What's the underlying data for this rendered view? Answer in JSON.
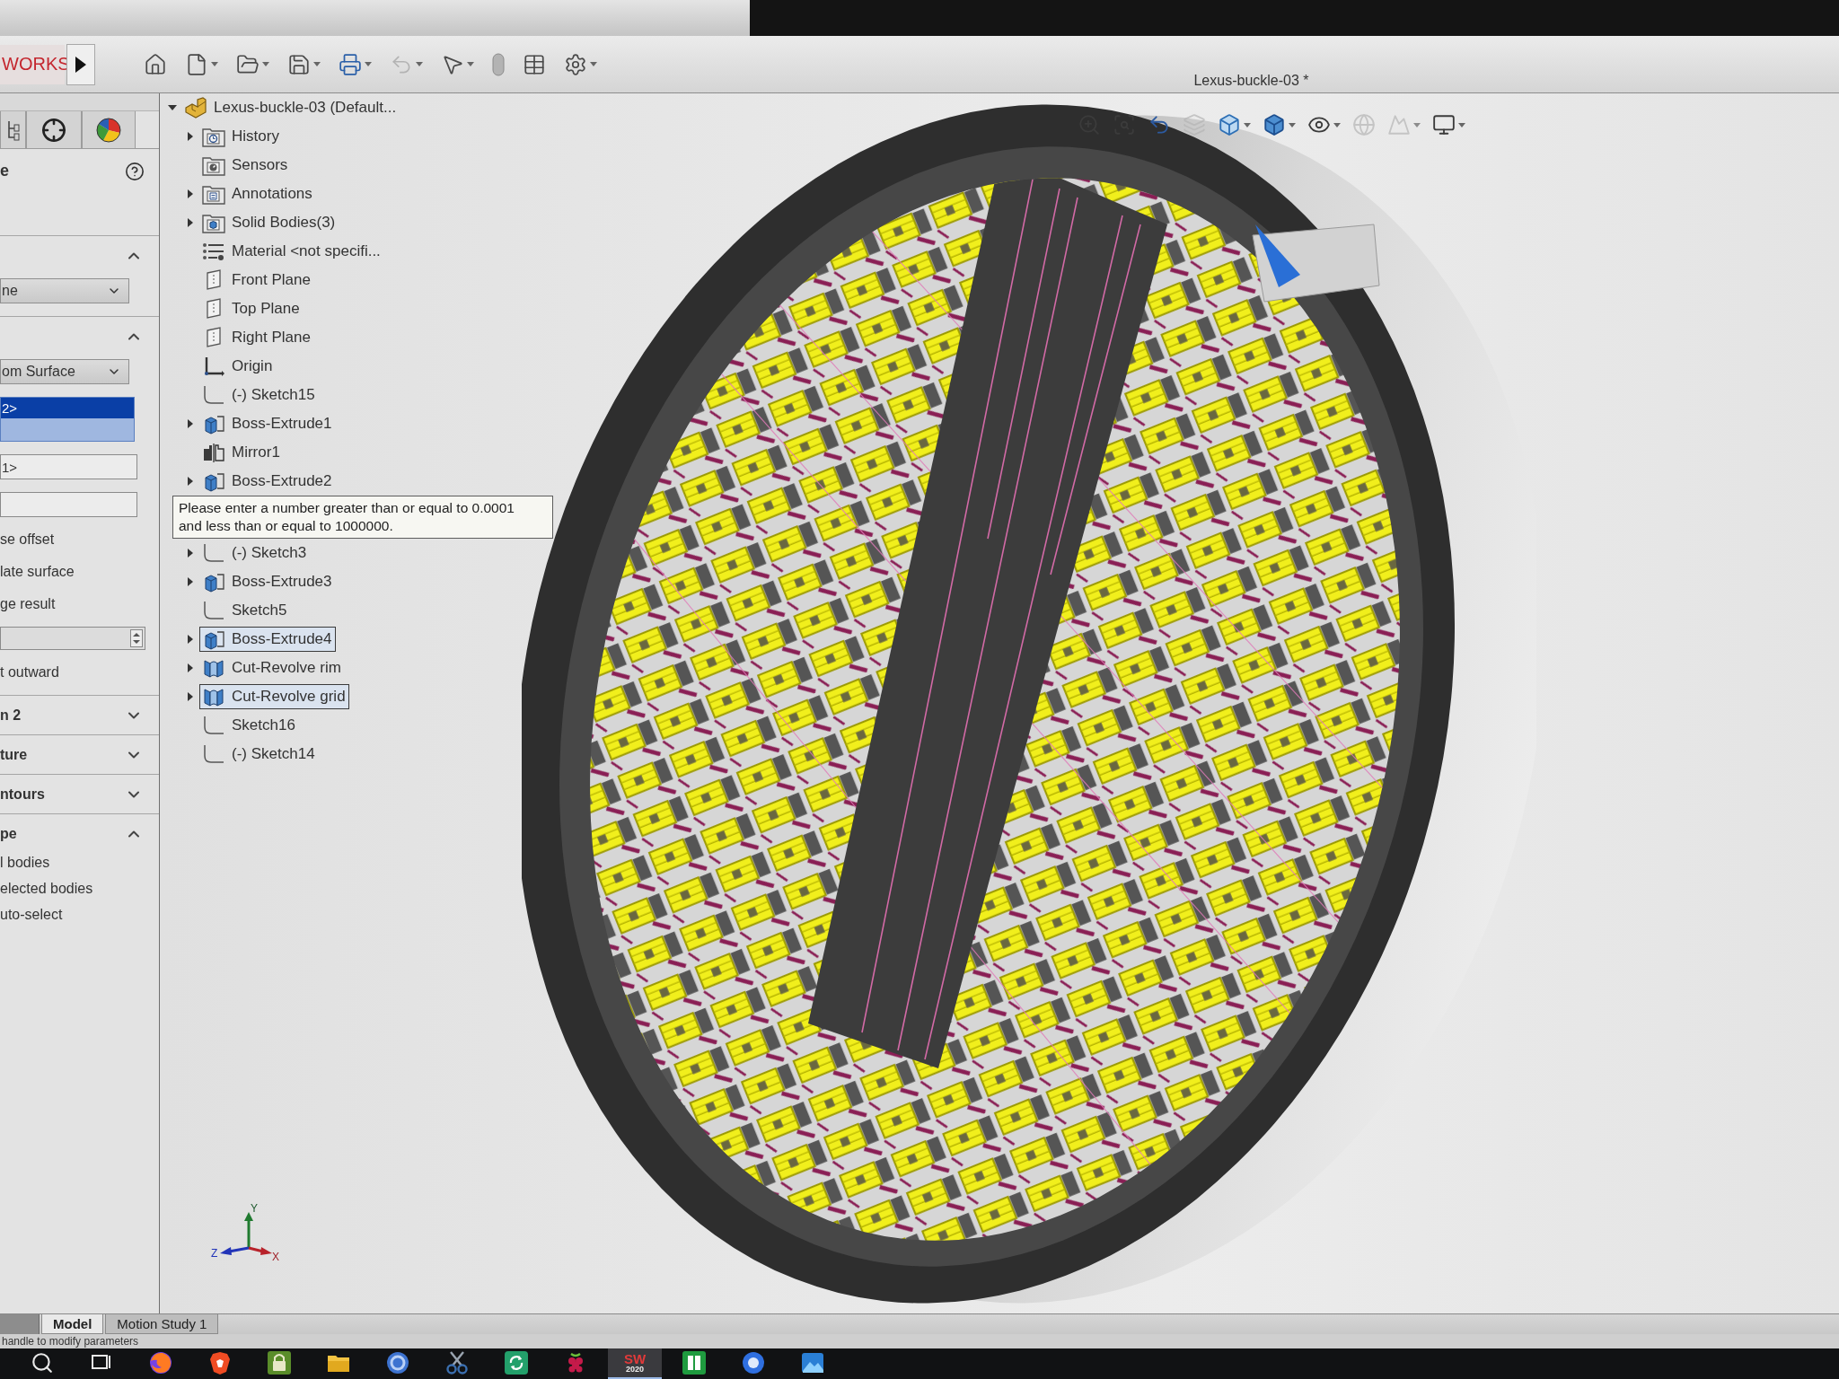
{
  "top_bar": {
    "logo": "WORKS",
    "tools": [
      {
        "kind": "home",
        "menu": false,
        "disabled": false
      },
      {
        "kind": "new",
        "menu": true,
        "disabled": false
      },
      {
        "kind": "open",
        "menu": true,
        "disabled": false
      },
      {
        "kind": "save",
        "menu": true,
        "disabled": false
      },
      {
        "kind": "print",
        "menu": true,
        "disabled": false
      },
      {
        "kind": "undo",
        "menu": true,
        "disabled": true
      },
      {
        "kind": "select",
        "menu": true,
        "disabled": false
      },
      {
        "kind": "rebuild",
        "menu": false,
        "disabled": true
      },
      {
        "kind": "properties",
        "menu": false,
        "disabled": false
      },
      {
        "kind": "options",
        "menu": true,
        "disabled": false
      }
    ],
    "document_title": "Lexus-buckle-03 *"
  },
  "property_manager": {
    "tabs": [
      {
        "kind": "tree",
        "selected": false
      },
      {
        "kind": "crosshair",
        "selected": false
      },
      {
        "kind": "appearance",
        "selected": false
      }
    ],
    "title": "e",
    "sections": [
      {
        "expanded": true,
        "controls": [
          {
            "kind": "dropdown",
            "value": "ne"
          }
        ]
      },
      {
        "expanded": true,
        "controls": [
          {
            "kind": "dropdown",
            "value": "om Surface"
          },
          {
            "kind": "selection_list",
            "items": [
              {
                "text": "2>",
                "selected": true
              }
            ]
          },
          {
            "kind": "field",
            "value": "1>"
          },
          {
            "kind": "field"
          },
          {
            "kind": "label",
            "text": "se offset"
          },
          {
            "kind": "label",
            "text": "late surface"
          },
          {
            "kind": "label",
            "text": "ge result"
          },
          {
            "kind": "spin_field"
          },
          {
            "kind": "label",
            "text": "t outward"
          }
        ]
      },
      {
        "title": "n 2",
        "expanded": false
      },
      {
        "title": "ture",
        "expanded": false
      },
      {
        "title": "ntours",
        "expanded": false
      },
      {
        "title": "pe",
        "expanded": true,
        "controls": [
          {
            "kind": "label",
            "text": "l bodies"
          },
          {
            "kind": "label",
            "text": "elected bodies"
          },
          {
            "kind": "label",
            "text": "uto-select"
          }
        ]
      }
    ]
  },
  "feature_tree": {
    "root": {
      "label": "Lexus-buckle-03 (Default...",
      "kind": "part",
      "expanded": true,
      "selected": false,
      "children": [
        {
          "label": "History",
          "kind": "history",
          "expanded": false,
          "selected": false
        },
        {
          "label": "Sensors",
          "kind": "sensors",
          "selected": false
        },
        {
          "label": "Annotations",
          "kind": "annotations",
          "expanded": false,
          "selected": false
        },
        {
          "label": "Solid Bodies(3)",
          "kind": "bodies",
          "expanded": false,
          "selected": false
        },
        {
          "label": "Material <not specifi...",
          "kind": "material",
          "selected": false
        },
        {
          "label": "Front Plane",
          "kind": "plane",
          "selected": false
        },
        {
          "label": "Top Plane",
          "kind": "plane",
          "selected": false
        },
        {
          "label": "Right Plane",
          "kind": "plane",
          "selected": false
        },
        {
          "label": "Origin",
          "kind": "origin",
          "selected": false
        },
        {
          "label": "(-) Sketch15",
          "kind": "sketch",
          "selected": false
        },
        {
          "label": "Boss-Extrude1",
          "kind": "extrude",
          "expanded": false,
          "selected": false
        },
        {
          "label": "Mirror1",
          "kind": "mirror",
          "selected": false
        },
        {
          "label": "Boss-Extrude2",
          "kind": "extrude",
          "expanded": false,
          "selected": false
        },
        {
          "label": "(-) Sketch3",
          "kind": "sketch",
          "expanded": false,
          "selected": false
        },
        {
          "label": "Boss-Extrude3",
          "kind": "extrude",
          "expanded": false,
          "selected": false
        },
        {
          "label": "Sketch5",
          "kind": "sketch",
          "selected": false
        },
        {
          "label": "Boss-Extrude4",
          "kind": "extrude",
          "expanded": false,
          "selected": true
        },
        {
          "label": "Cut-Revolve rim",
          "kind": "revolve",
          "expanded": false,
          "selected": false
        },
        {
          "label": "Cut-Revolve grid",
          "kind": "revolve",
          "expanded": false,
          "selected": true
        },
        {
          "label": "Sketch16",
          "kind": "sketch",
          "selected": false
        },
        {
          "label": "(-) Sketch14",
          "kind": "sketch",
          "selected": false
        }
      ]
    }
  },
  "tooltip": {
    "text": "Please enter a number greater than or equal to 0.0001\nand less than or equal to 1000000."
  },
  "view_toolbar": {
    "tools": [
      {
        "kind": "zoom_fit",
        "menu": false,
        "disabled": false
      },
      {
        "kind": "zoom_area",
        "menu": false,
        "disabled": false
      },
      {
        "kind": "previous_view",
        "menu": false,
        "disabled": false
      },
      {
        "kind": "section_view",
        "menu": false,
        "disabled": true
      },
      {
        "kind": "orientation",
        "menu": true,
        "disabled": false
      },
      {
        "kind": "display_style",
        "menu": true,
        "disabled": false
      },
      {
        "kind": "hide_show",
        "menu": true,
        "disabled": false
      },
      {
        "kind": "appearance",
        "menu": false,
        "disabled": true
      },
      {
        "kind": "scene",
        "menu": true,
        "disabled": true
      },
      {
        "kind": "view_settings",
        "menu": true,
        "disabled": false
      }
    ]
  },
  "triad": {
    "axes": [
      {
        "kind": "y",
        "label": "Y"
      },
      {
        "kind": "z",
        "label": "Z"
      },
      {
        "kind": "x",
        "label": "X"
      }
    ]
  },
  "bottom_tabs": [
    {
      "label": "Model",
      "selected": true
    },
    {
      "label": "Motion Study 1",
      "selected": false
    }
  ],
  "status_bar": {
    "text": "handle to modify parameters"
  },
  "taskbar": {
    "apps": [
      {
        "kind": "search",
        "selected": false
      },
      {
        "kind": "task_view",
        "selected": false
      },
      {
        "kind": "fox_globe",
        "selected": false
      },
      {
        "kind": "lion_shield",
        "selected": false
      },
      {
        "kind": "lock",
        "selected": false
      },
      {
        "kind": "folder",
        "selected": false
      },
      {
        "kind": "ring",
        "selected": false
      },
      {
        "kind": "scissors",
        "selected": false
      },
      {
        "kind": "refresh",
        "selected": false
      },
      {
        "kind": "berry",
        "selected": false
      },
      {
        "kind": "logo",
        "logo_text": "SW",
        "version": "2020",
        "selected": true
      },
      {
        "kind": "columns",
        "selected": false
      },
      {
        "kind": "disc",
        "selected": false
      },
      {
        "kind": "picture",
        "selected": false
      }
    ]
  }
}
